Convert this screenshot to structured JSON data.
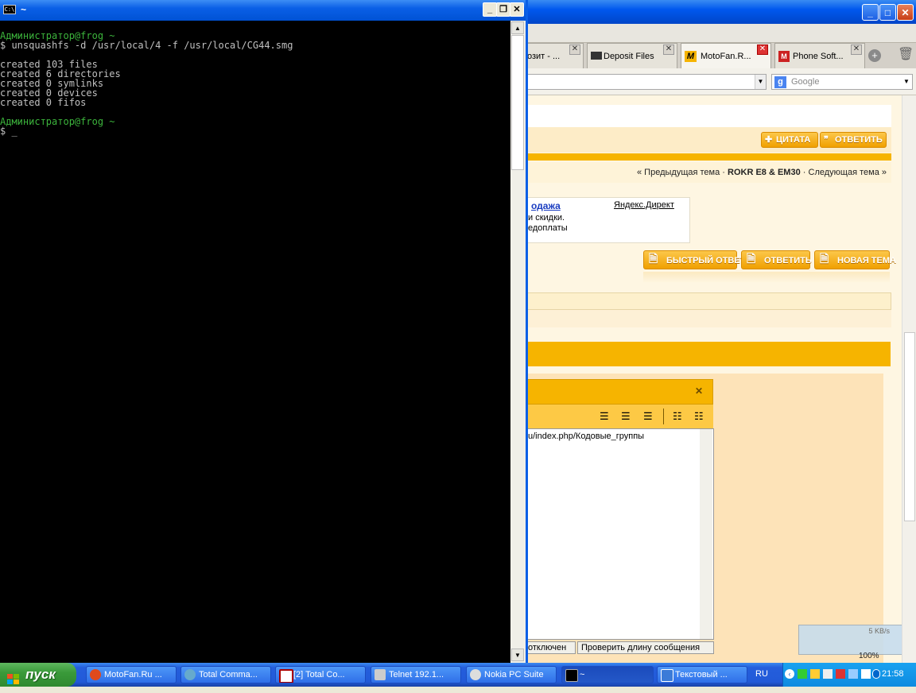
{
  "browser": {
    "tabs": [
      {
        "label": "озит - ..."
      },
      {
        "label": "Deposit Files"
      },
      {
        "label": "MotoFan.R..."
      },
      {
        "label": "Phone Soft..."
      }
    ],
    "search_placeholder": "Google",
    "quote_button": "ЦИТАТА",
    "reply_button": "ОТВЕТИТЬ",
    "topic_nav": {
      "prev": "« Предыдущая тема",
      "sep1": "·",
      "current": "ROKR E8 & EM30",
      "sep2": "·",
      "next": "Следующая тема »"
    },
    "ad": {
      "link": "одажа",
      "line1": "и скидки.",
      "line2": "едоплаты",
      "yandex": "Яндекс.Директ"
    },
    "buttons": {
      "quick_reply": "БЫСТРЫЙ ОТВЕТ",
      "reply": "ОТВЕТИТЬ",
      "new_topic": "НОВАЯ ТЕМА"
    },
    "editor_text": "u/index.php/Кодовые_группы",
    "status_left": "отключен",
    "status_right": "Проверить длину сообщения",
    "download_speed": "5 KB/s",
    "zoom": "100%"
  },
  "console": {
    "title": "~",
    "icon_text": "C:\\",
    "lines": [
      {
        "text": "Администратор@frog ~",
        "color": "green"
      },
      {
        "text": "$ unsquashfs -d /usr/local/4 -f /usr/local/CG44.smg",
        "color": "gray"
      },
      {
        "text": "",
        "color": "gray"
      },
      {
        "text": "created 103 files",
        "color": "gray"
      },
      {
        "text": "created 6 directories",
        "color": "gray"
      },
      {
        "text": "created 0 symlinks",
        "color": "gray"
      },
      {
        "text": "created 0 devices",
        "color": "gray"
      },
      {
        "text": "created 0 fifos",
        "color": "gray"
      },
      {
        "text": "",
        "color": "gray"
      },
      {
        "text": "Администратор@frog ~",
        "color": "green"
      },
      {
        "text": "$ _",
        "color": "gray"
      }
    ]
  },
  "taskbar": {
    "start": "пуск",
    "tasks": [
      {
        "label": "MotoFan.Ru ..."
      },
      {
        "label": "Total Comma..."
      },
      {
        "label": "[2] Total Co..."
      },
      {
        "label": "Telnet 192.1..."
      },
      {
        "label": "Nokia PC Suite"
      },
      {
        "label": "~"
      },
      {
        "label": "Текстовый ..."
      }
    ],
    "lang": "RU",
    "clock": "21:58"
  },
  "colors": {
    "xp_blue": "#0a5fe6",
    "forum_orange": "#f6b400",
    "console_green": "#3cb43c"
  }
}
